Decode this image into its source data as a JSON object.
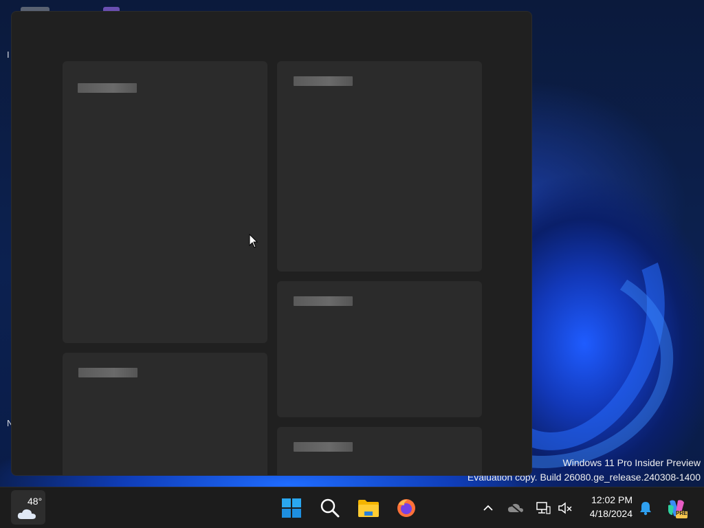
{
  "desktop": {
    "edge_chars": [
      "I",
      "N"
    ]
  },
  "watermark": {
    "line1": "Windows 11 Pro Insider Preview",
    "line2": "Evaluation copy. Build 26080.ge_release.240308-1400"
  },
  "taskbar": {
    "weather": {
      "temp": "48°",
      "icon": "cloud-icon"
    },
    "apps": [
      {
        "name": "start-button",
        "icon": "windows-logo-icon"
      },
      {
        "name": "search-button",
        "icon": "search-icon"
      },
      {
        "name": "file-explorer-button",
        "icon": "folder-icon"
      },
      {
        "name": "firefox-button",
        "icon": "firefox-icon"
      }
    ],
    "tray": {
      "icons": [
        "chevron-up-icon",
        "onedrive-offline-icon",
        "network-icon",
        "volume-muted-icon"
      ],
      "time": "12:02 PM",
      "date": "4/18/2024",
      "copilot_badge": "PRE"
    }
  },
  "colors": {
    "panel_bg": "#202020",
    "card_bg": "#2b2b2b",
    "taskbar_bg": "#1c1c1c",
    "accent": "#0078d4"
  }
}
